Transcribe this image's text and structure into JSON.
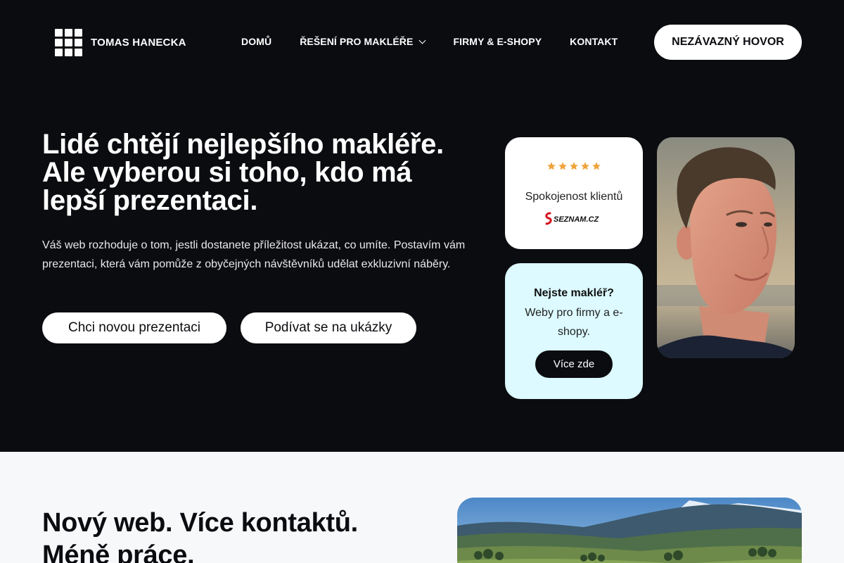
{
  "brand": {
    "name": "TOMAS HANECKA",
    "logo_icon": "grid-logo-icon"
  },
  "nav": {
    "items": [
      {
        "label": "DOMŮ"
      },
      {
        "label": "ŘEŠENÍ PRO MAKLÉŘE",
        "has_dropdown": true
      },
      {
        "label": "FIRMY & E-SHOPY"
      },
      {
        "label": "KONTAKT"
      }
    ],
    "cta_label": "NEZÁVAZNÝ HOVOR"
  },
  "hero": {
    "title_lines": [
      "Lidé chtějí nejlepšího makléře.",
      "Ale vyberou si toho, kdo má",
      "lepší prezentaci."
    ],
    "description": "Váš web rozhoduje o tom, jestli dostanete příležitost ukázat, co umíte. Postavím vám prezentaci, která vám pomůže z obyčejných návštěvníků udělat exkluzivní náběry.",
    "primary_button": "Chci novou prezentaci",
    "secondary_button": "Podívat se na ukázky"
  },
  "rating_card": {
    "stars": 5,
    "label": "Spokojenost klientů",
    "logo_text": "SEZNAM.CZ"
  },
  "promo_card": {
    "title": "Nejste makléř?",
    "text": "Weby pro firmy a e-shopy.",
    "button": "Více zde"
  },
  "section2": {
    "title_lines": [
      "Nový web. Více kontaktů.",
      "Méně práce."
    ]
  },
  "colors": {
    "background": "#0b0c10",
    "promo_card": "#dcfaff",
    "star": "#f0a23a",
    "section2_bg": "#f7f8fa"
  }
}
